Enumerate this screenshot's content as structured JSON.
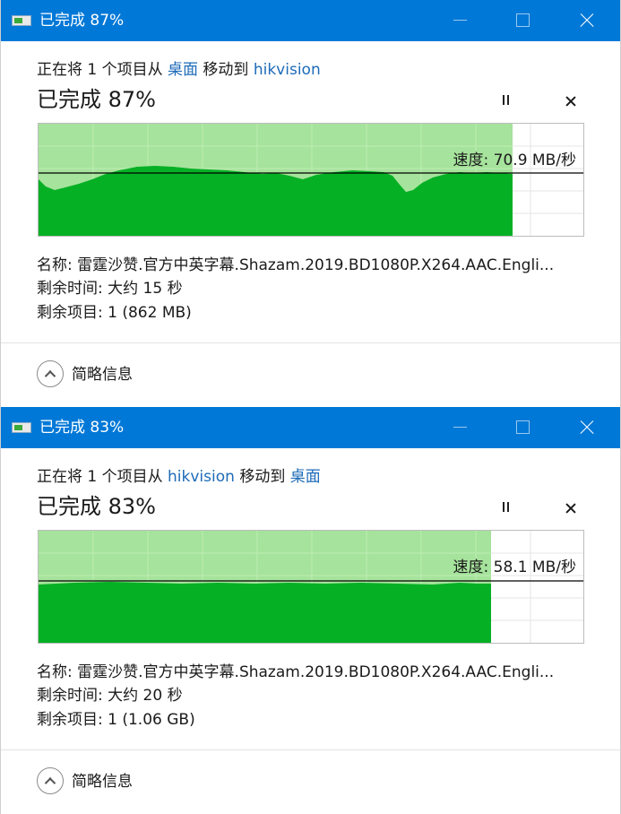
{
  "dialogs": [
    {
      "title": "已完成 87%",
      "op_prefix": "正在将 1 个项目从 ",
      "op_source": "桌面",
      "op_middle": " 移动到 ",
      "op_dest": "hikvision",
      "status": "已完成 87%",
      "speed": "速度: 70.9 MB/秒",
      "name_label": "名称: ",
      "name_value": "雷霆沙赞.官方中英字幕.Shazam.2019.BD1080P.X264.AAC.Engli...",
      "time_label": "剩余时间: ",
      "time_value": "大约 15 秒",
      "items_label": "剩余项目: ",
      "items_value": "1 (862 MB)",
      "collapse_label": "简略信息",
      "progress": 0.87
    },
    {
      "title": "已完成 83%",
      "op_prefix": "正在将 1 个项目从 ",
      "op_source": "hikvision",
      "op_middle": " 移动到 ",
      "op_dest": "桌面",
      "status": "已完成 83%",
      "speed": "速度: 58.1 MB/秒",
      "name_label": "名称: ",
      "name_value": "雷霆沙赞.官方中英字幕.Shazam.2019.BD1080P.X264.AAC.Engli...",
      "time_label": "剩余时间: ",
      "time_value": "大约 20 秒",
      "items_label": "剩余项目: ",
      "items_value": "1 (1.06 GB)",
      "collapse_label": "简略信息",
      "progress": 0.83
    }
  ],
  "colors": {
    "titlebar": "#0078d7",
    "graph_fill": "#06b025",
    "graph_progress_bg": "#a6e39c",
    "link": "#1e6bb8"
  },
  "icons": [
    "file-transfer-icon",
    "pause-icon",
    "stop-icon",
    "collapse-chevron-icon"
  ]
}
